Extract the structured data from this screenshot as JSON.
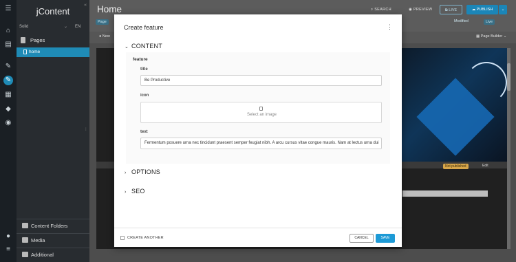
{
  "app": {
    "brand": "jContent",
    "collapse_glyph": "«"
  },
  "sidebar": {
    "site": "Solid",
    "language": "EN",
    "section": "Pages",
    "tree_item": "home",
    "bottom": [
      {
        "label": "Content Folders",
        "icon": "folder-icon"
      },
      {
        "label": "Media",
        "icon": "image-icon"
      },
      {
        "label": "Additional",
        "icon": "grid-icon"
      }
    ]
  },
  "rail": {
    "icons": [
      "menu-icon",
      "home-icon",
      "clipboard-icon",
      "edit-icon",
      "content-icon",
      "calendar-icon",
      "tag-icon",
      "compass-icon",
      "user-icon",
      "burger-icon"
    ]
  },
  "header": {
    "title": "Home",
    "search": "SEARCH",
    "preview": "PREVIEW",
    "live": "LIVE",
    "publish": "PUBLISH",
    "page_tag": "Page",
    "modified": "Modified",
    "live_tag": "Live",
    "new": "New",
    "page_builder": "Page Builder"
  },
  "canvas": {
    "badge": "Not published",
    "edit": "Edit"
  },
  "modal": {
    "title": "Create feature",
    "sections": {
      "content": "CONTENT",
      "options": "OPTIONS",
      "seo": "SEO"
    },
    "group_label": "feature",
    "fields": {
      "title": {
        "label": "title",
        "value": "Be Productive"
      },
      "icon": {
        "label": "icon",
        "placeholder": "Select an image"
      },
      "text": {
        "label": "text",
        "value": "Fermentum posuere urna nec tincidunt praesent semper feugiat nibh. A arcu cursus vitae congue mauris. Nam at lectus urna dui"
      }
    },
    "footer": {
      "create_another": "CREATE ANOTHER",
      "cancel": "CANCEL",
      "save": "SAVE"
    }
  },
  "colors": {
    "accent": "#1d9ad6",
    "sidebar": "#282c30",
    "rail": "#1a1f24",
    "badge": "#d7a64a"
  }
}
